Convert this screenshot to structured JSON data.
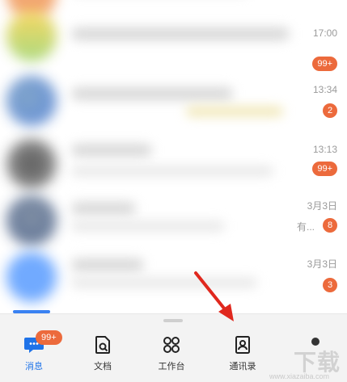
{
  "conversations": [
    {
      "time": "",
      "badge": ""
    },
    {
      "time": "17:00",
      "badge": "99+"
    },
    {
      "time": "13:34",
      "badge": "2"
    },
    {
      "time": "13:13",
      "badge": "99+"
    },
    {
      "time": "3月3日",
      "badge": "8",
      "snippet_tail": "有..."
    },
    {
      "time": "3月3日",
      "badge": "3"
    }
  ],
  "tabbar": {
    "tabs": [
      {
        "label": "消息",
        "icon": "message-icon",
        "badge": "99+"
      },
      {
        "label": "文档",
        "icon": "document-icon"
      },
      {
        "label": "工作台",
        "icon": "workbench-icon"
      },
      {
        "label": "通讯录",
        "icon": "contacts-icon"
      }
    ]
  },
  "watermark": {
    "text": "下载",
    "sub": "www.xiazaiba.com"
  },
  "colors": {
    "accent": "#1f73e8",
    "badge": "#ec6a3c"
  }
}
